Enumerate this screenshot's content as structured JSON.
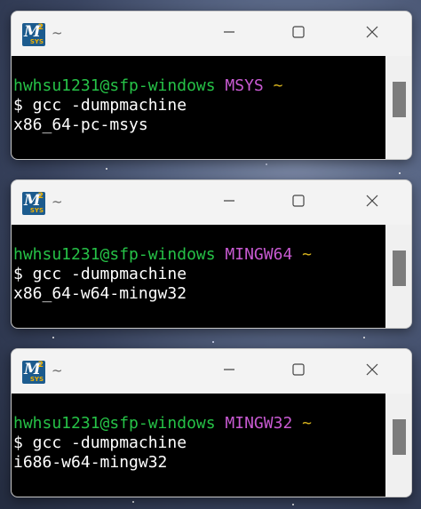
{
  "windows": [
    {
      "title": "~",
      "prompt_user": "hwhsu1231@sfp-windows",
      "env": "MSYS",
      "dir": "~",
      "command": "$ gcc -dumpmachine",
      "output": "x86_64-pc-msys"
    },
    {
      "title": "~",
      "prompt_user": "hwhsu1231@sfp-windows",
      "env": "MINGW64",
      "dir": "~",
      "command": "$ gcc -dumpmachine",
      "output": "x86_64-w64-mingw32"
    },
    {
      "title": "~",
      "prompt_user": "hwhsu1231@sfp-windows",
      "env": "MINGW32",
      "dir": "~",
      "command": "$ gcc -dumpmachine",
      "output": "i686-w64-mingw32"
    }
  ],
  "app_icon": {
    "letter": "M",
    "superscript": "2",
    "subtext": "SYS"
  },
  "colors": {
    "prompt_user": "#26c247",
    "prompt_env": "#c85ad2",
    "prompt_dir": "#d7b31d",
    "terminal_bg": "#000000",
    "text": "#ffffff"
  },
  "icons": {
    "minimize": "minimize-icon",
    "maximize": "maximize-icon",
    "close": "close-icon"
  }
}
